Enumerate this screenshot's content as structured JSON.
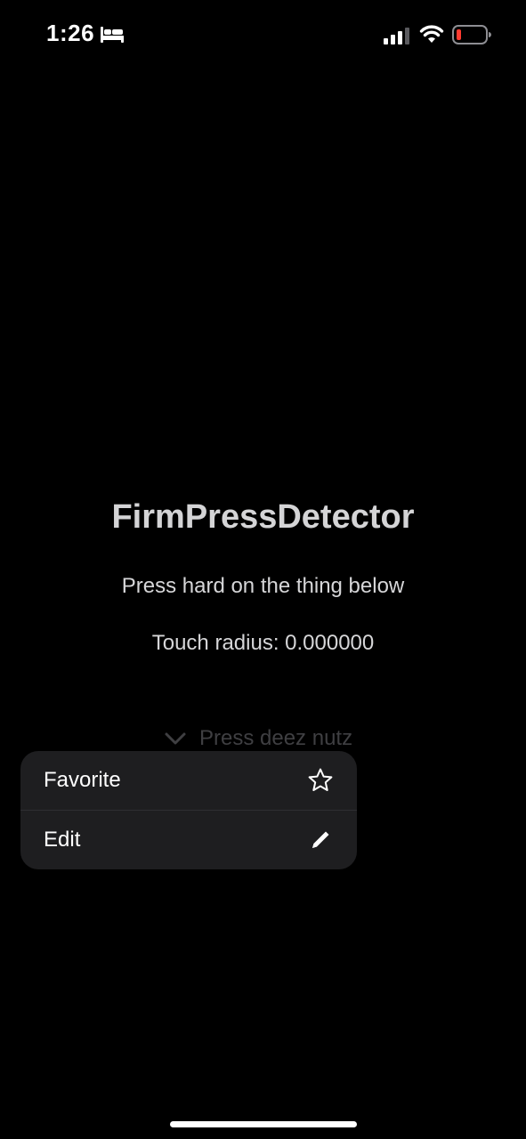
{
  "status_bar": {
    "time": "1:26",
    "sleep_icon": "bed-icon",
    "signal_icon": "cellular-signal-icon",
    "wifi_icon": "wifi-icon",
    "battery_icon": "battery-low-icon",
    "battery_level": 0.1,
    "battery_color": "#ff3b30"
  },
  "main": {
    "title": "FirmPressDetector",
    "instruction": "Press hard on the thing below",
    "radius_label": "Touch radius: 0.000000"
  },
  "press_button": {
    "label": "Press deez nutz",
    "icon": "chevron-down-icon"
  },
  "context_menu": {
    "items": [
      {
        "label": "Favorite",
        "icon": "star-icon"
      },
      {
        "label": "Edit",
        "icon": "pencil-icon"
      }
    ]
  },
  "colors": {
    "background": "#000000",
    "menu_background": "#1e1e20",
    "text_primary": "#ffffff",
    "text_secondary": "#d6d6d8",
    "dimmed_button": "#3f3f42"
  }
}
